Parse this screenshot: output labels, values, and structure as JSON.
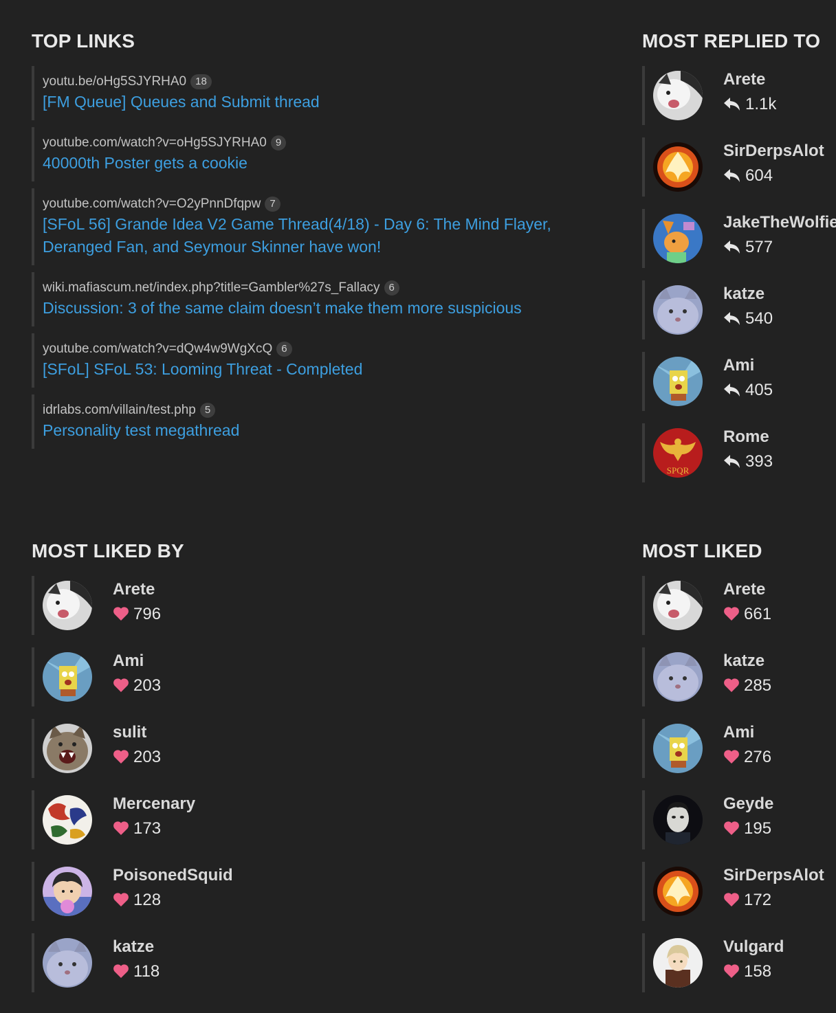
{
  "top_links": {
    "title": "TOP LINKS",
    "items": [
      {
        "url": "youtu.be/oHg5SJYRHA0",
        "count": "18",
        "title": "[FM Queue] Queues and Submit thread"
      },
      {
        "url": "youtube.com/watch?v=oHg5SJYRHA0",
        "count": "9",
        "title": "40000th Poster gets a cookie"
      },
      {
        "url": "youtube.com/watch?v=O2yPnnDfqpw",
        "count": "7",
        "title": "[SFoL 56] Grande Idea V2 Game Thread(4/18) - Day 6: The Mind Flayer, Deranged Fan, and Seymour Skinner have won!"
      },
      {
        "url": "wiki.mafiascum.net/index.php?title=Gambler%27s_Fallacy",
        "count": "6",
        "title": "Discussion: 3 of the same claim doesn’t make them more suspicious"
      },
      {
        "url": "youtube.com/watch?v=dQw4w9WgXcQ",
        "count": "6",
        "title": "[SFoL] SFoL 53: Looming Threat - Completed"
      },
      {
        "url": "idrlabs.com/villain/test.php",
        "count": "5",
        "title": "Personality test megathread"
      }
    ]
  },
  "most_replied_to": {
    "title": "MOST REPLIED TO",
    "icon": "reply-icon",
    "users": [
      {
        "name": "Arete",
        "value": "1.1k",
        "avatar": "cat-avatar"
      },
      {
        "name": "SirDerpsAlot",
        "value": "604",
        "avatar": "phoenix-avatar"
      },
      {
        "name": "JakeTheWolfie",
        "value": "577",
        "avatar": "cartoon-dog-avatar"
      },
      {
        "name": "katze",
        "value": "540",
        "avatar": "gray-cat-avatar"
      },
      {
        "name": "Ami",
        "value": "405",
        "avatar": "sponge-avatar"
      },
      {
        "name": "Rome",
        "value": "393",
        "avatar": "spqr-eagle-avatar",
        "avatar_text": "SPQR"
      }
    ]
  },
  "most_liked_by": {
    "title": "MOST LIKED BY",
    "icon": "heart-icon",
    "users": [
      {
        "name": "Arete",
        "value": "796",
        "avatar": "cat-avatar"
      },
      {
        "name": "Ami",
        "value": "203",
        "avatar": "sponge-avatar"
      },
      {
        "name": "sulit",
        "value": "203",
        "avatar": "hissing-cat-avatar"
      },
      {
        "name": "Mercenary",
        "value": "173",
        "avatar": "dragons-avatar"
      },
      {
        "name": "PoisonedSquid",
        "value": "128",
        "avatar": "anime-boy-avatar"
      },
      {
        "name": "katze",
        "value": "118",
        "avatar": "gray-cat-avatar"
      }
    ]
  },
  "most_liked": {
    "title": "MOST LIKED",
    "icon": "heart-icon",
    "users": [
      {
        "name": "Arete",
        "value": "661",
        "avatar": "cat-avatar"
      },
      {
        "name": "katze",
        "value": "285",
        "avatar": "gray-cat-avatar"
      },
      {
        "name": "Ami",
        "value": "276",
        "avatar": "sponge-avatar"
      },
      {
        "name": "Geyde",
        "value": "195",
        "avatar": "masked-man-avatar"
      },
      {
        "name": "SirDerpsAlot",
        "value": "172",
        "avatar": "phoenix-avatar"
      },
      {
        "name": "Vulgard",
        "value": "158",
        "avatar": "anime-character-avatar"
      }
    ]
  },
  "colors": {
    "link": "#3d9fe0",
    "heart": "#ee5f88",
    "background": "#222222"
  }
}
